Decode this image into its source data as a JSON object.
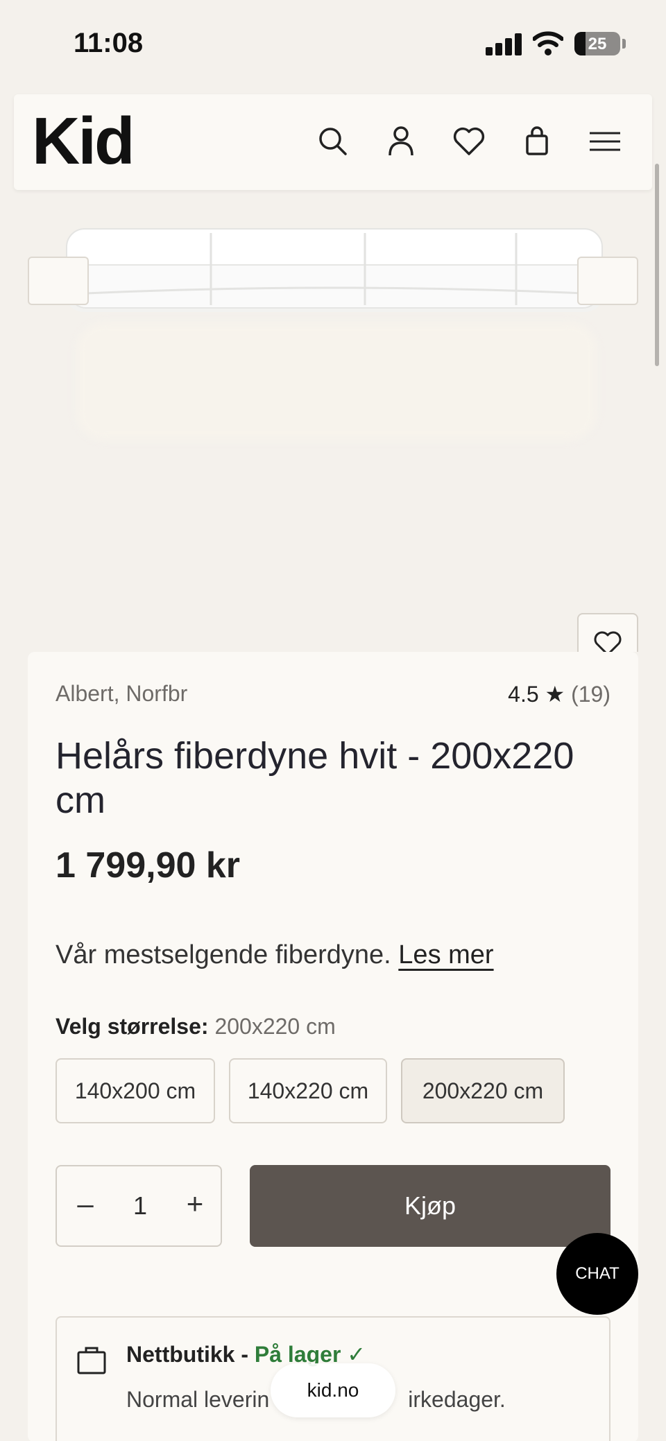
{
  "status_bar": {
    "time": "11:08",
    "battery": "25"
  },
  "header": {
    "logo": "Kid",
    "icons": [
      "search-icon",
      "user-icon",
      "heart-icon",
      "bag-icon",
      "menu-icon"
    ]
  },
  "product": {
    "brand": "Albert, Norfbr",
    "rating": "4.5",
    "rating_star": "★",
    "rating_count": "(19)",
    "title": "Helårs fiberdyne hvit - 200x220 cm",
    "price": "1 799,90 kr",
    "description": "Vår mestselgende fiberdyne.",
    "read_more": "Les mer",
    "size_label": "Velg størrelse:",
    "size_value": "200x220 cm",
    "sizes": [
      "140x200 cm",
      "140x220 cm",
      "200x220 cm"
    ],
    "selected_size_index": 2,
    "quantity": "1",
    "qty_minus": "–",
    "qty_plus": "+",
    "buy_label": "Kjøp"
  },
  "stock": {
    "store": "Nettbutikk -",
    "status": "På lager",
    "check": "✓",
    "delivery_start": "Normal leverin",
    "delivery_end": "irkedager."
  },
  "chat_label": "CHAT",
  "url": "kid.no",
  "colors": {
    "buy_button": "#5c5550",
    "in_stock": "#2f7d3a",
    "background": "#f4f1ec"
  }
}
